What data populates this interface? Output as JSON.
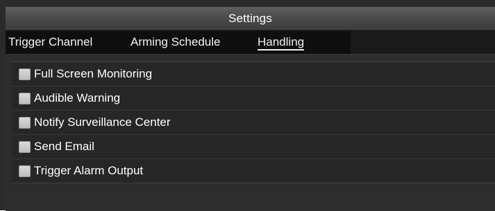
{
  "window": {
    "title": "Settings"
  },
  "tabs": [
    {
      "label": "Trigger Channel",
      "active": false
    },
    {
      "label": "Arming Schedule",
      "active": false
    },
    {
      "label": "Handling",
      "active": true
    }
  ],
  "handling": {
    "options": [
      {
        "label": "Full Screen Monitoring",
        "checked": false
      },
      {
        "label": "Audible Warning",
        "checked": false
      },
      {
        "label": "Notify Surveillance Center",
        "checked": false
      },
      {
        "label": "Send Email",
        "checked": false
      },
      {
        "label": "Trigger Alarm Output",
        "checked": false
      }
    ]
  },
  "colors": {
    "background": "#2b2b2b",
    "title_bar": "#4a4a4a",
    "tab_strip": "#0f0f0f",
    "text": "#ffffff",
    "checkbox": "#cfcfcf"
  }
}
